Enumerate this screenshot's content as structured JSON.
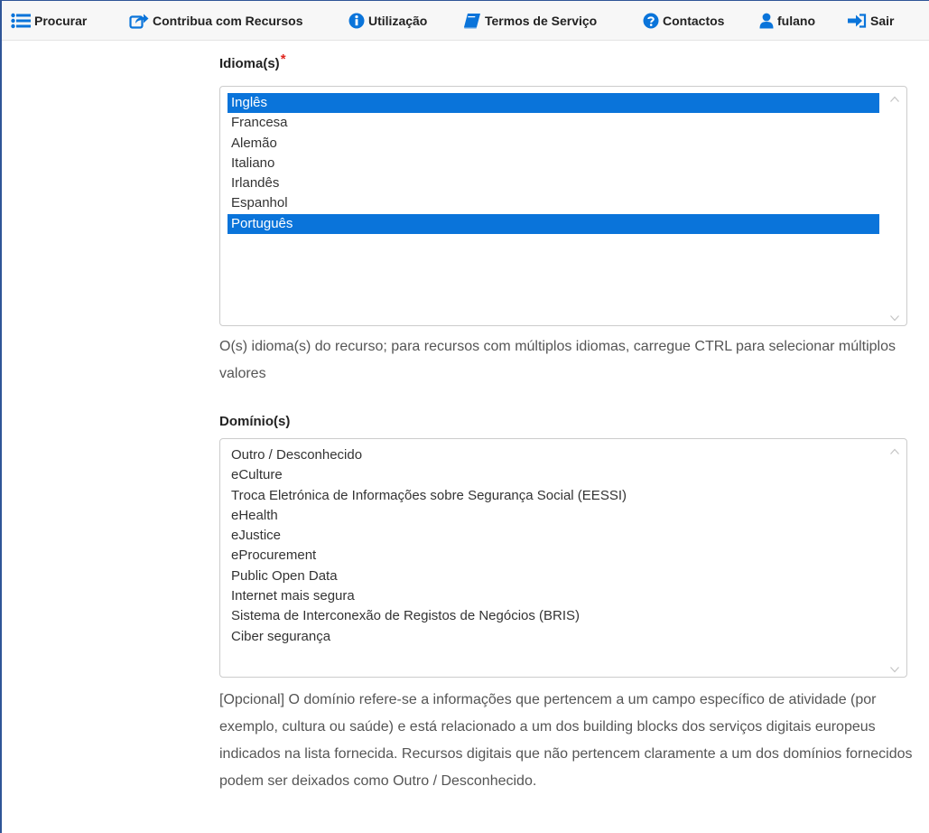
{
  "nav": {
    "search": "Procurar",
    "contribute": "Contribua com Recursos",
    "usage": "Utilização",
    "terms": "Termos de Serviço",
    "contacts": "Contactos",
    "user": "fulano",
    "logout": "Sair"
  },
  "languages": {
    "label": "Idioma(s)",
    "required_marker": "*",
    "options": [
      {
        "label": "Inglês",
        "selected": true
      },
      {
        "label": "Francesa",
        "selected": false
      },
      {
        "label": "Alemão",
        "selected": false
      },
      {
        "label": "Italiano",
        "selected": false
      },
      {
        "label": "Irlandês",
        "selected": false
      },
      {
        "label": "Espanhol",
        "selected": false
      },
      {
        "label": "Português",
        "selected": true
      }
    ],
    "help": "O(s) idioma(s) do recurso; para recursos com múltiplos idiomas, carregue CTRL para selecionar múltiplos valores"
  },
  "domains": {
    "label": "Domínio(s)",
    "options": [
      {
        "label": "Outro / Desconhecido",
        "selected": false
      },
      {
        "label": "eCulture",
        "selected": false
      },
      {
        "label": "Troca Eletrónica de Informações sobre Segurança Social (EESSI)",
        "selected": false
      },
      {
        "label": "eHealth",
        "selected": false
      },
      {
        "label": "eJustice",
        "selected": false
      },
      {
        "label": "eProcurement",
        "selected": false
      },
      {
        "label": "Public Open Data",
        "selected": false
      },
      {
        "label": "Internet mais segura",
        "selected": false
      },
      {
        "label": "Sistema de Interconexão de Registos de Negócios (BRIS)",
        "selected": false
      },
      {
        "label": "Ciber segurança",
        "selected": false
      }
    ],
    "help": "[Opcional] O domínio refere-se a informações que pertencem a um campo específico de atividade (por exemplo, cultura ou saúde) e está relacionado a um dos building blocks dos serviços digitais europeus indicados na lista fornecida. Recursos digitais que não pertencem claramente a um dos domínios fornecidos podem ser deixados como Outro / Desconhecido."
  },
  "colors": {
    "icon_blue": "#0a74da",
    "selection": "#0a74da",
    "required": "#e0261f"
  }
}
